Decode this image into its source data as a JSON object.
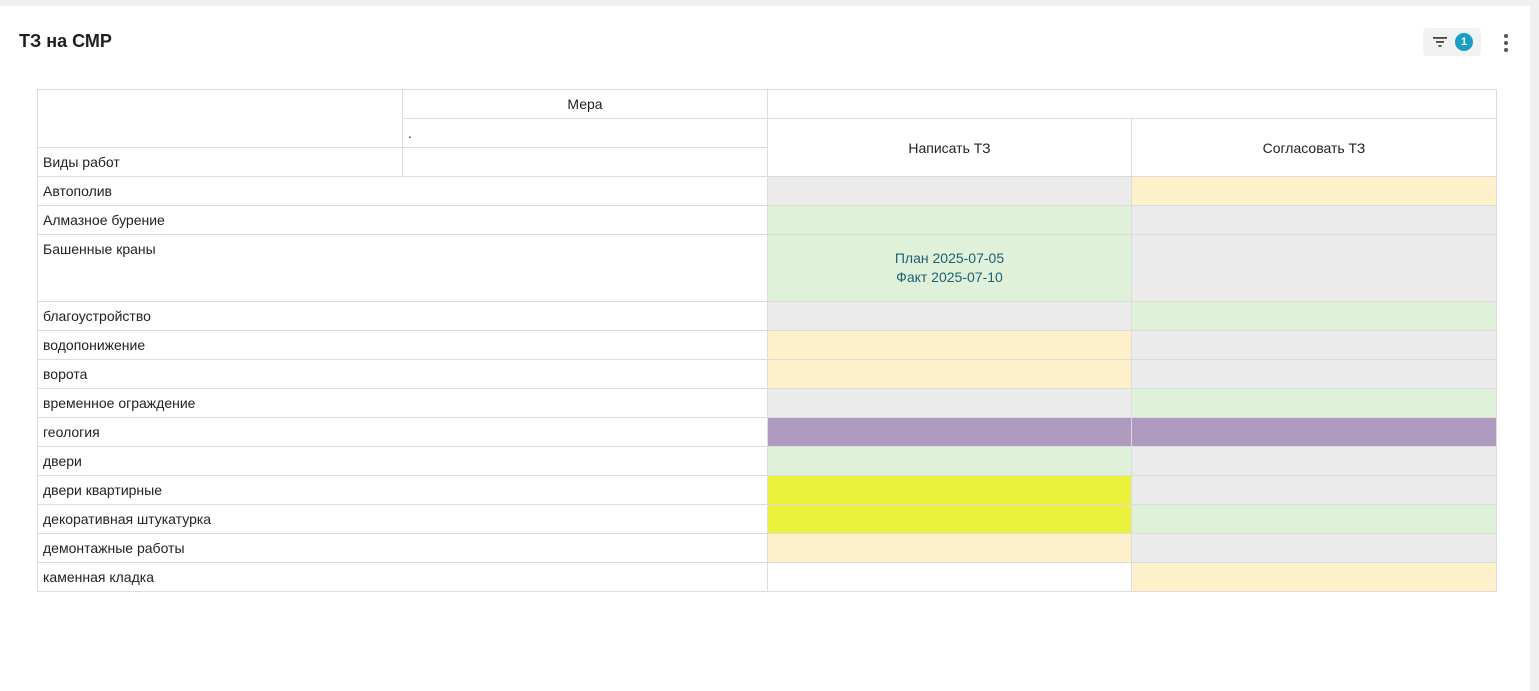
{
  "page": {
    "title": "ТЗ на СМР"
  },
  "toolbar": {
    "filter_count": "1",
    "filter_icon": "filter-icon",
    "menu_icon": "more-vertical-icon"
  },
  "colors": {
    "gray": "#ebebeb",
    "cream": "#fff0cc",
    "green": "#dff1d9",
    "purple": "#ae9abf",
    "yellow": "#ecf23b",
    "white": "#ffffff",
    "badge": "#1a9fc4",
    "cell_text": "#1e5f74"
  },
  "table": {
    "measure_header": "Мера",
    "measure_sub": ".",
    "row_header": "Виды работ",
    "columns": [
      "Написать ТЗ",
      "Согласовать ТЗ"
    ],
    "rows": [
      {
        "label": "Автополив",
        "cells": [
          {
            "color": "gray"
          },
          {
            "color": "cream"
          }
        ]
      },
      {
        "label": "Алмазное бурение",
        "cells": [
          {
            "color": "green"
          },
          {
            "color": "gray"
          }
        ]
      },
      {
        "label": "Башенные краны",
        "cells": [
          {
            "color": "green",
            "plan": "План 2025-07-05",
            "fact": "Факт 2025-07-10"
          },
          {
            "color": "gray"
          }
        ]
      },
      {
        "label": "благоустройство",
        "cells": [
          {
            "color": "gray"
          },
          {
            "color": "green"
          }
        ]
      },
      {
        "label": "водопонижение",
        "cells": [
          {
            "color": "cream"
          },
          {
            "color": "gray"
          }
        ]
      },
      {
        "label": "ворота",
        "cells": [
          {
            "color": "cream"
          },
          {
            "color": "gray"
          }
        ]
      },
      {
        "label": "временное ограждение",
        "cells": [
          {
            "color": "gray"
          },
          {
            "color": "green"
          }
        ]
      },
      {
        "label": "геология",
        "cells": [
          {
            "color": "purple"
          },
          {
            "color": "purple"
          }
        ]
      },
      {
        "label": "двери",
        "cells": [
          {
            "color": "green"
          },
          {
            "color": "gray"
          }
        ]
      },
      {
        "label": "двери квартирные",
        "cells": [
          {
            "color": "yellow"
          },
          {
            "color": "gray"
          }
        ]
      },
      {
        "label": "декоративная штукатурка",
        "cells": [
          {
            "color": "yellow"
          },
          {
            "color": "green"
          }
        ]
      },
      {
        "label": "демонтажные работы",
        "cells": [
          {
            "color": "cream"
          },
          {
            "color": "gray"
          }
        ]
      },
      {
        "label": "каменная кладка",
        "cells": [
          {
            "color": "white"
          },
          {
            "color": "cream"
          }
        ]
      }
    ]
  }
}
